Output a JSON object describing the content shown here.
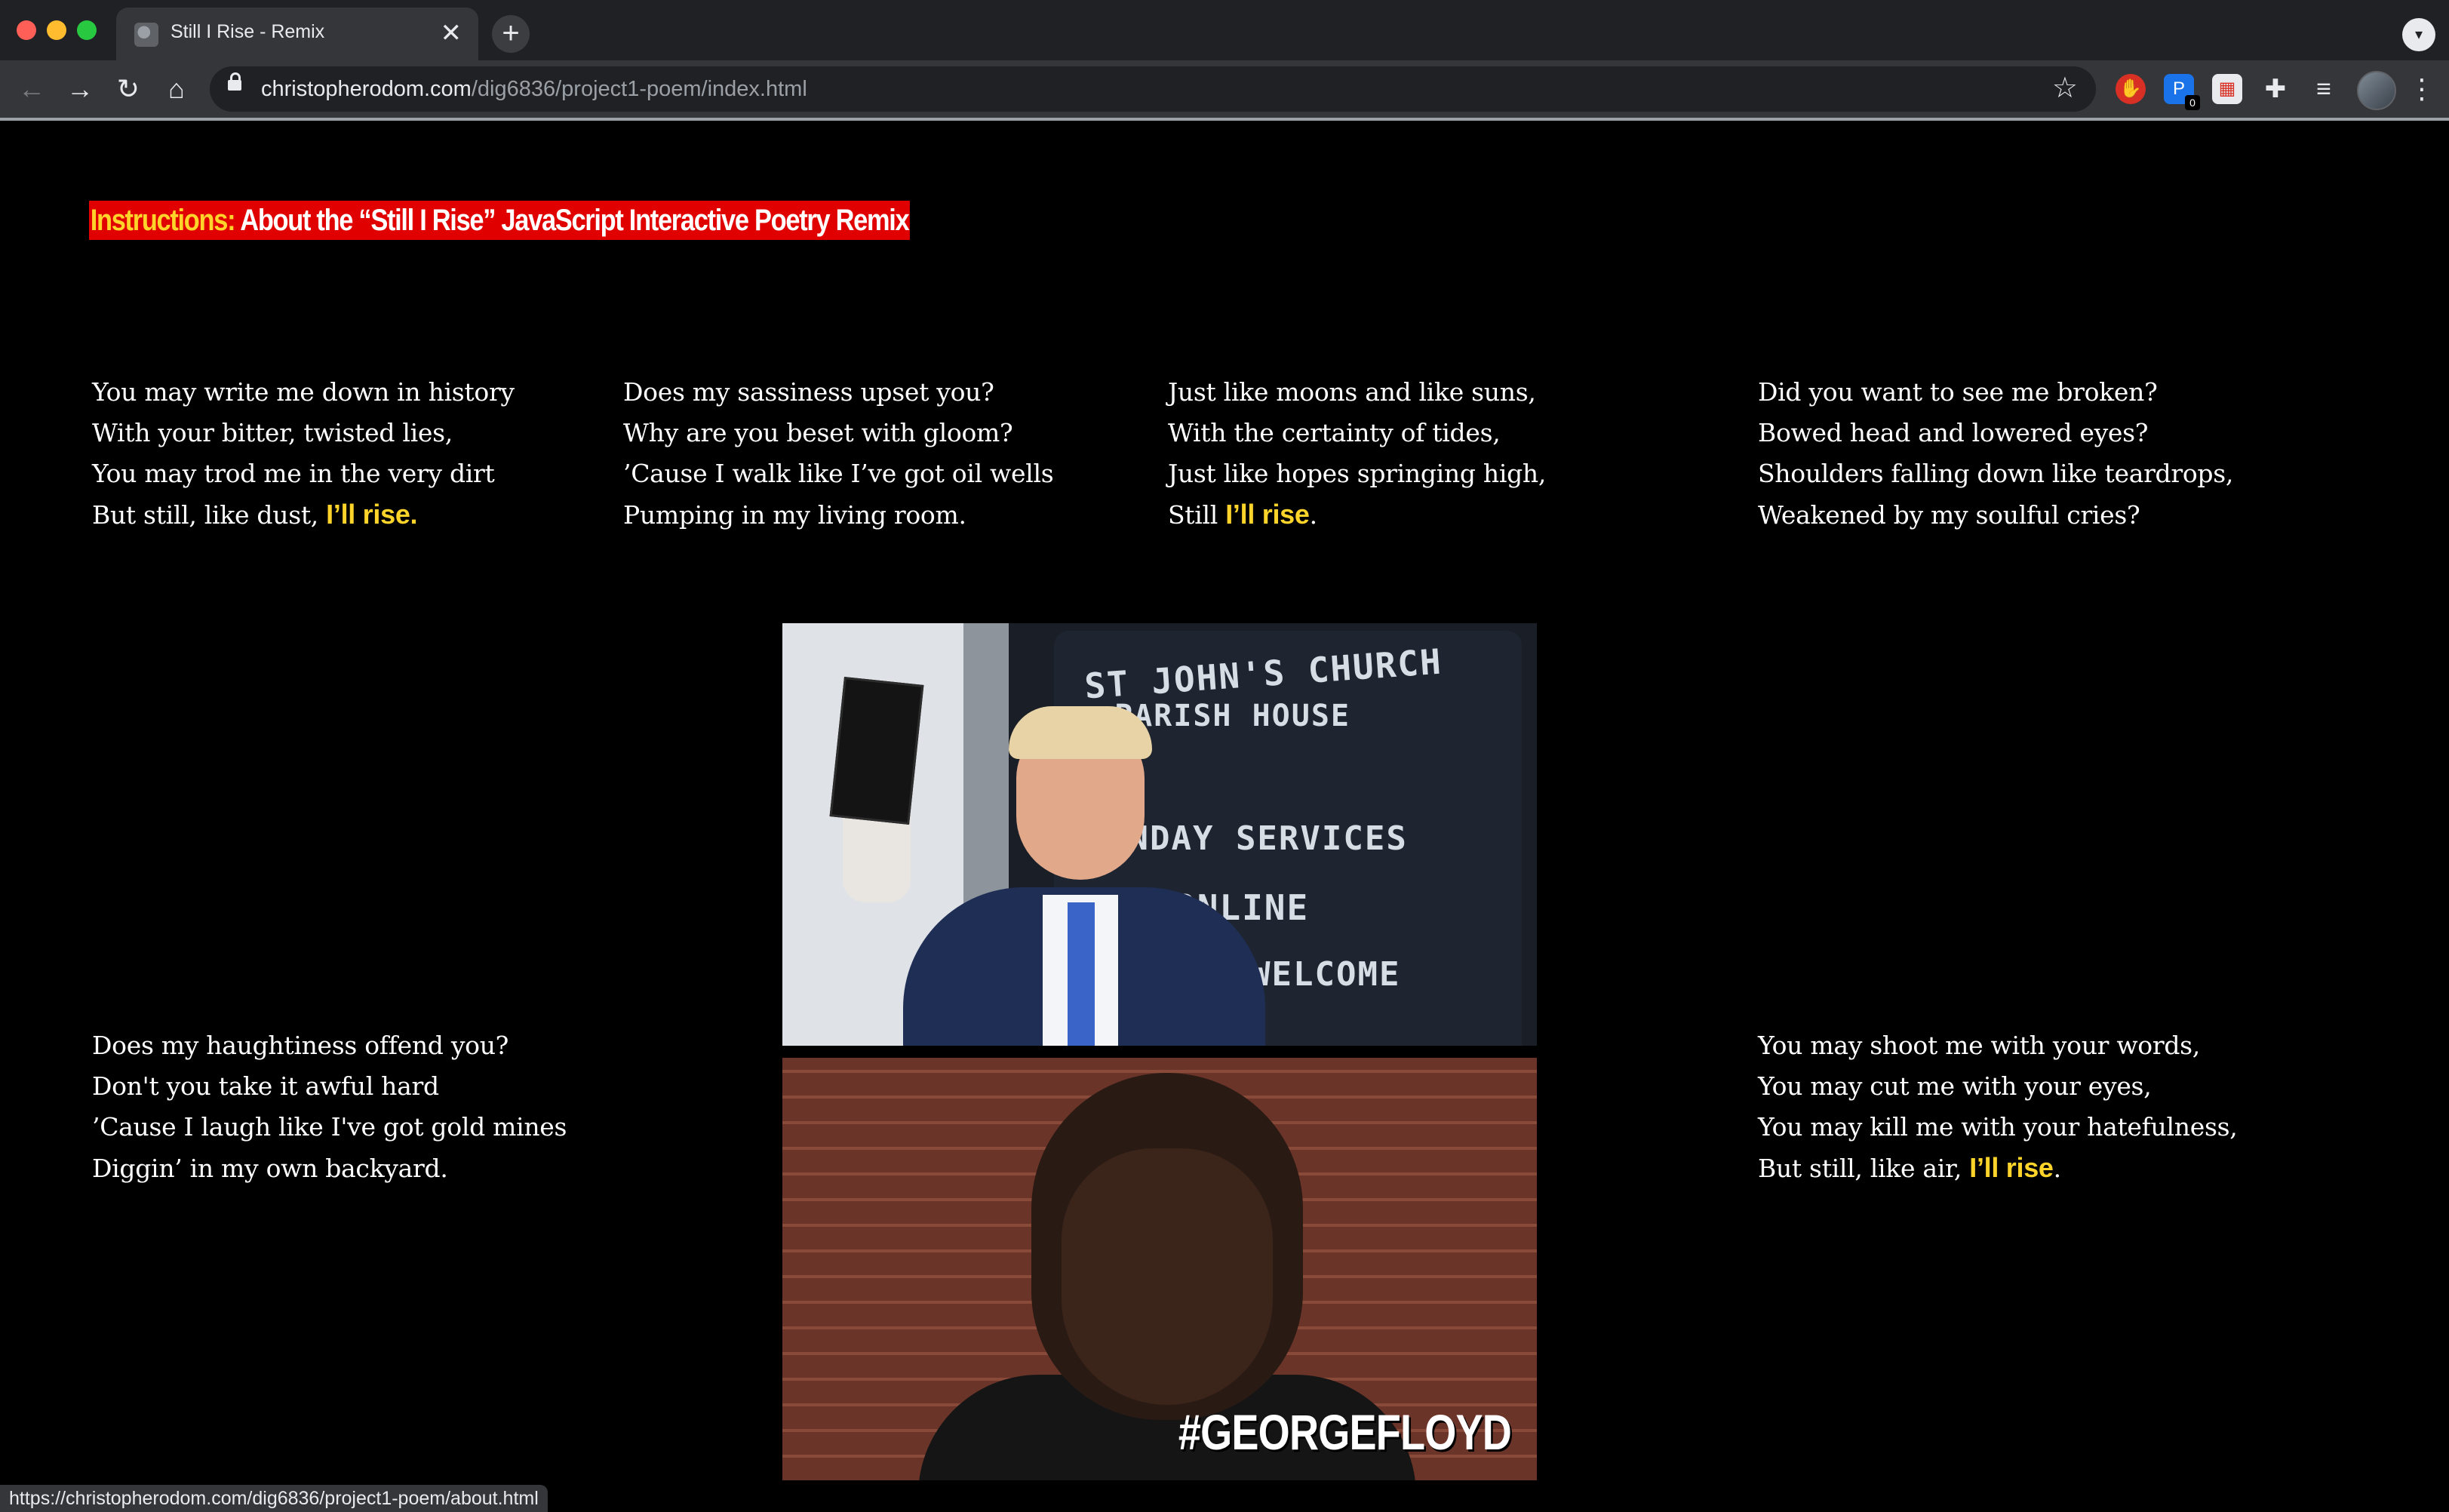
{
  "browser": {
    "tab_title": "Still I Rise - Remix",
    "tab_close": "✕",
    "new_tab": "+",
    "url_host": "christopherodom.com",
    "url_path": "/dig6836/project1-poem/index.html",
    "extension_badge": "0",
    "status_url": "https://christopherodom.com/dig6836/project1-poem/about.html"
  },
  "page": {
    "instructions_lead": "Instructions:",
    "instructions_text": " About the “Still I Rise” JavaScript Interactive Poetry Remix"
  },
  "stanzas": [
    {
      "lines": [
        "You may write me down in history",
        "With your bitter, twisted lies,",
        "You may trod me in the very dirt"
      ],
      "last_prefix": "But still, like dust, ",
      "highlight": "I’ll rise.",
      "last_suffix": ""
    },
    {
      "lines": [
        "Does my sassiness upset you?",
        "Why are you beset with gloom?",
        "’Cause I walk like I’ve got oil wells"
      ],
      "last_prefix": "Pumping in my living room.",
      "highlight": "",
      "last_suffix": ""
    },
    {
      "lines": [
        "Just like moons and like suns,",
        "With the certainty of tides,",
        "Just like hopes springing high,"
      ],
      "last_prefix": "Still ",
      "highlight": "I’ll rise",
      "last_suffix": "."
    },
    {
      "lines": [
        "Did you want to see me broken?",
        "Bowed head and lowered eyes?",
        "Shoulders falling down like teardrops,"
      ],
      "last_prefix": "Weakened by my soulful cries?",
      "highlight": "",
      "last_suffix": ""
    },
    {
      "lines": [
        "Does my haughtiness offend you?",
        "Don't you take it awful hard",
        "’Cause I laugh like I've got gold mines"
      ],
      "last_prefix": "Diggin’ in my own backyard.",
      "highlight": "",
      "last_suffix": ""
    },
    {
      "lines": [
        "You may shoot me with your words,",
        "You may cut me with your eyes,",
        "You may kill me with your hatefulness,"
      ],
      "last_prefix": "But still, like air, ",
      "highlight": "I’ll rise",
      "last_suffix": "."
    }
  ],
  "photo_top": {
    "sign_lines": [
      "ST JOHN'S CHURCH",
      "PARISH HOUSE",
      "UNDAY SERVICES",
      "ONLINE",
      "WELCOME"
    ]
  },
  "photo_bottom": {
    "hashtag": "#GEORGEFLOYD"
  },
  "colors": {
    "highlight": "#ffd42a",
    "instructions_bg": "#e00000",
    "background": "#000000"
  }
}
